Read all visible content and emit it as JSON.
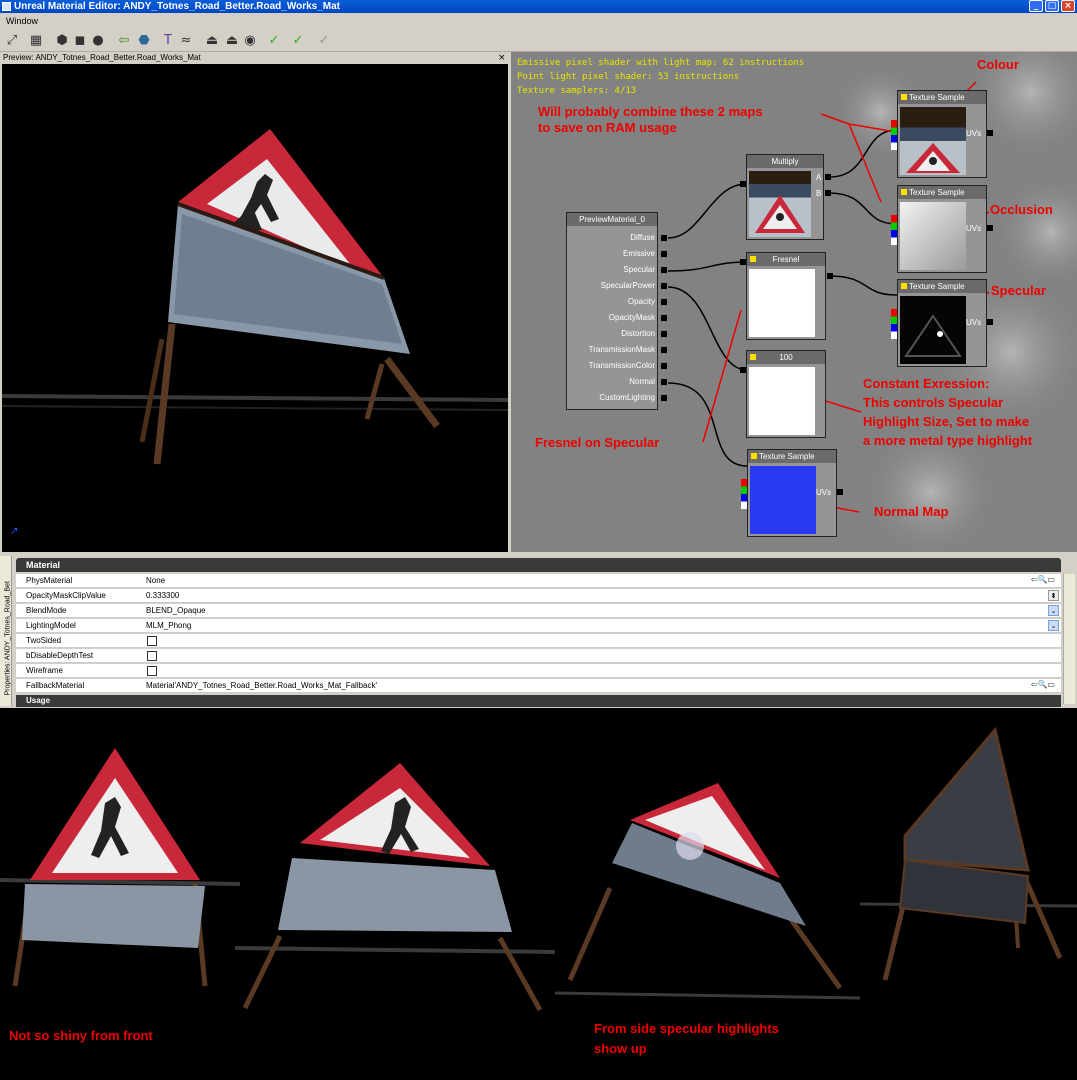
{
  "window": {
    "title": "Unreal Material Editor: ANDY_Totnes_Road_Better.Road_Works_Mat"
  },
  "menu": {
    "window_label": "Window"
  },
  "preview": {
    "header": "Preview: ANDY_Totnes_Road_Better.Road_Works_Mat",
    "close": "×"
  },
  "stats": [
    "Emissive pixel shader with light map: 62 instructions",
    "Point light pixel shader: 53 instructions",
    "Texture samplers: 4/13"
  ],
  "nodes": {
    "preview_material": {
      "title": "PreviewMaterial_0",
      "pins": [
        "Diffuse",
        "Emissive",
        "Specular",
        "SpecularPower",
        "Opacity",
        "OpacityMask",
        "Distortion",
        "TransmissionMask",
        "TransmissionColor",
        "Normal",
        "CustomLighting"
      ]
    },
    "multiply": {
      "title": "Multiply",
      "pin_a": "A",
      "pin_b": "B"
    },
    "fresnel": {
      "title": "Fresnel"
    },
    "constant": {
      "title": "100"
    },
    "texture_colour": {
      "title": "Texture Sample",
      "uvs": "UVs"
    },
    "texture_occlusion": {
      "title": "Texture Sample",
      "uvs": "UVs"
    },
    "texture_specular": {
      "title": "Texture Sample",
      "uvs": "UVs"
    },
    "texture_normal": {
      "title": "Texture Sample",
      "uvs": "UVs"
    }
  },
  "annotations": {
    "colour": "Colour",
    "combine": "Will probably combine these 2 maps\nto save on RAM usage",
    "occlusion": "Occlusion",
    "specular": "Specular",
    "constant": "Constant Exression:\nThis controls Specular\nHighlight Size, Set to make\na more metal type highlight",
    "fresnel": "Fresnel on Specular",
    "normal": "Normal Map"
  },
  "properties": {
    "side_label": "Properties: ANDY_Totnes_Road_Bet",
    "category": "Material",
    "next_category": "Usage",
    "rows": [
      {
        "name": "PhysMaterial",
        "value": "None"
      },
      {
        "name": "OpacityMaskClipValue",
        "value": "0.333300"
      },
      {
        "name": "BlendMode",
        "value": "BLEND_Opaque"
      },
      {
        "name": "LightingModel",
        "value": "MLM_Phong"
      },
      {
        "name": "TwoSided",
        "value": ""
      },
      {
        "name": "bDisableDepthTest",
        "value": ""
      },
      {
        "name": "Wireframe",
        "value": ""
      },
      {
        "name": "FallbackMaterial",
        "value": "Material'ANDY_Totnes_Road_Better.Road_Works_Mat_Fallback'"
      }
    ]
  },
  "captions": {
    "front": "Not so shiny from front",
    "side": "From side specular highlights\nshow up"
  }
}
